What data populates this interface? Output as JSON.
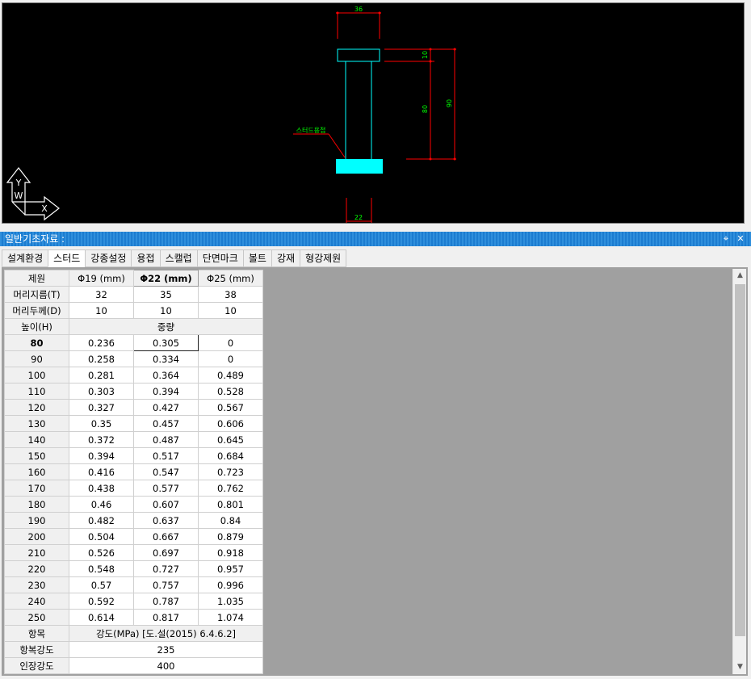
{
  "cad": {
    "dims": {
      "top_width": "36",
      "head_thickness": "10",
      "shank_length": "80",
      "total_height": "90",
      "bottom_width": "22"
    },
    "label": "스터드용접",
    "axis_y": "Y",
    "axis_w": "W",
    "axis_x": "X",
    "colors": {
      "cyan": "#00ffff",
      "red": "#ff0000",
      "green": "#00ff00",
      "white": "#ffffff"
    }
  },
  "panel": {
    "title": "일반기초자료 :",
    "pin_icon": "pin-icon",
    "close_icon": "close-icon"
  },
  "tabs": [
    "설계환경",
    "스터드",
    "강종설정",
    "용접",
    "스캘럽",
    "단면마크",
    "볼트",
    "강재",
    "형강제원"
  ],
  "grid": {
    "header": {
      "corner": "제원",
      "cols": [
        "Φ19 (mm)",
        "Φ22 (mm)",
        "Φ25 (mm)"
      ]
    },
    "head_diameter": {
      "label": "머리지름(T)",
      "values": [
        "32",
        "35",
        "38"
      ]
    },
    "head_thickness": {
      "label": "머리두께(D)",
      "values": [
        "10",
        "10",
        "10"
      ]
    },
    "height_header": {
      "label": "높이(H)",
      "weight": "중량"
    },
    "rows": [
      {
        "h": "80",
        "v": [
          "0.236",
          "0.305",
          "0"
        ]
      },
      {
        "h": "90",
        "v": [
          "0.258",
          "0.334",
          "0"
        ]
      },
      {
        "h": "100",
        "v": [
          "0.281",
          "0.364",
          "0.489"
        ]
      },
      {
        "h": "110",
        "v": [
          "0.303",
          "0.394",
          "0.528"
        ]
      },
      {
        "h": "120",
        "v": [
          "0.327",
          "0.427",
          "0.567"
        ]
      },
      {
        "h": "130",
        "v": [
          "0.35",
          "0.457",
          "0.606"
        ]
      },
      {
        "h": "140",
        "v": [
          "0.372",
          "0.487",
          "0.645"
        ]
      },
      {
        "h": "150",
        "v": [
          "0.394",
          "0.517",
          "0.684"
        ]
      },
      {
        "h": "160",
        "v": [
          "0.416",
          "0.547",
          "0.723"
        ]
      },
      {
        "h": "170",
        "v": [
          "0.438",
          "0.577",
          "0.762"
        ]
      },
      {
        "h": "180",
        "v": [
          "0.46",
          "0.607",
          "0.801"
        ]
      },
      {
        "h": "190",
        "v": [
          "0.482",
          "0.637",
          "0.84"
        ]
      },
      {
        "h": "200",
        "v": [
          "0.504",
          "0.667",
          "0.879"
        ]
      },
      {
        "h": "210",
        "v": [
          "0.526",
          "0.697",
          "0.918"
        ]
      },
      {
        "h": "220",
        "v": [
          "0.548",
          "0.727",
          "0.957"
        ]
      },
      {
        "h": "230",
        "v": [
          "0.57",
          "0.757",
          "0.996"
        ]
      },
      {
        "h": "240",
        "v": [
          "0.592",
          "0.787",
          "1.035"
        ]
      },
      {
        "h": "250",
        "v": [
          "0.614",
          "0.817",
          "1.074"
        ]
      }
    ],
    "strength_header": {
      "label": "항목",
      "value": "강도(MPa) [도.설(2015) 6.4.6.2]"
    },
    "yield": {
      "label": "항복강도",
      "value": "235"
    },
    "tensile": {
      "label": "인장강도",
      "value": "400"
    }
  }
}
